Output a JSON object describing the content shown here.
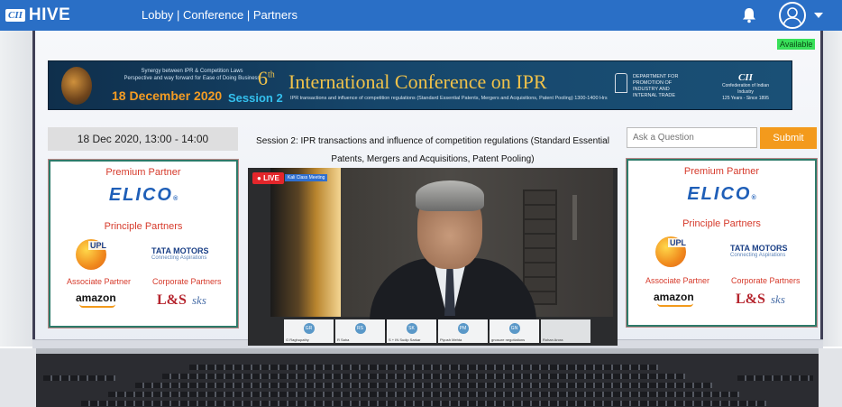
{
  "topbar": {
    "brand_cii": "CII",
    "brand_hive": "HIVE",
    "nav": "Lobby | Conference | Partners",
    "icons": [
      "bell-icon",
      "user-avatar-icon",
      "caret-down-icon"
    ]
  },
  "status": {
    "available": "Available"
  },
  "banner": {
    "tagline_1": "Synergy between IPR & Competition Laws",
    "tagline_2": "Perspective and way forward for Ease of Doing Business",
    "date": "18 December 2020",
    "edition": "6",
    "edition_sup": "th",
    "title": "International Conference on IPR",
    "session": "Session 2",
    "subtitle": "IPR transactions and influence of competition regulations (Standard Essential Patents, Mergers and Acquisitions, Patent Pooling) 1300-1400 Hrs",
    "dept_line_1": "DEPARTMENT FOR",
    "dept_line_2": "PROMOTION OF INDUSTRY AND",
    "dept_line_3": "INTERNAL TRADE",
    "cii_logo": "CII",
    "cii_line_1": "Confederation of Indian Industry",
    "cii_line_2": "125 Years - Since 1895"
  },
  "schedule": {
    "datetime": "18 Dec 2020, 13:00 - 14:00"
  },
  "session": {
    "title": "Session 2: IPR transactions and influence of competition regulations (Standard Essential Patents, Mergers and Acquisitions, Patent Pooling)"
  },
  "video": {
    "live_label": "LIVE",
    "speaker_tag": "Kali Class Meeting",
    "tiles": [
      {
        "initials": "GR",
        "name": "G Raghupathy"
      },
      {
        "initials": "RS",
        "name": "R Saha"
      },
      {
        "initials": "SK",
        "name": "S + IN Sudip Sarkar"
      },
      {
        "initials": "PM",
        "name": "Piyush Mehta"
      },
      {
        "initials": "GN",
        "name": "gnosure negotiations"
      },
      {
        "initials": "",
        "name": "Rohan Arora"
      }
    ]
  },
  "question": {
    "placeholder": "Ask a Question",
    "submit_label": "Submit"
  },
  "partners": {
    "premium_heading": "Premium Partner",
    "premium_logo": "ELICO",
    "principle_heading": "Principle Partners",
    "upl": "UPL",
    "tata": "TATA MOTORS",
    "tata_sub": "Connecting Aspirations",
    "associate_heading": "Associate Partner",
    "corporate_heading": "Corporate Partners",
    "amazon": "amazon",
    "lt": "L&S",
    "sks": "sks"
  }
}
